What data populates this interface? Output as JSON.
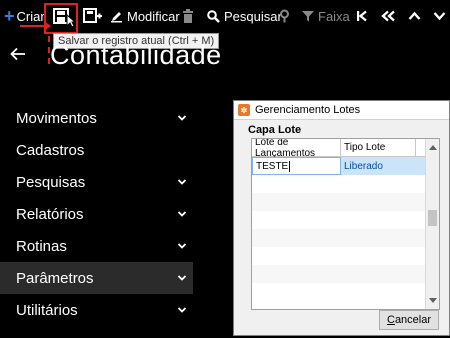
{
  "toolbar": {
    "criar": "Criar",
    "modificar": "Modificar",
    "pesquisar": "Pesquisar",
    "faixa": "Faixa",
    "tooltip": "Salvar o registro atual (Ctrl + M)"
  },
  "header": {
    "title": "Contabilidade"
  },
  "menu": {
    "items": [
      {
        "label": "Movimentos",
        "has_chevron": true
      },
      {
        "label": "Cadastros",
        "has_chevron": false
      },
      {
        "label": "Pesquisas",
        "has_chevron": true
      },
      {
        "label": "Relatórios",
        "has_chevron": true
      },
      {
        "label": "Rotinas",
        "has_chevron": true
      },
      {
        "label": "Parâmetros",
        "has_chevron": true,
        "active": true
      },
      {
        "label": "Utilitários",
        "has_chevron": true
      }
    ]
  },
  "dialog": {
    "title": "Gerenciamento Lotes",
    "section": "Capa Lote",
    "columns": [
      "Lote de Lançamentos",
      "Tipo Lote"
    ],
    "rows": [
      {
        "lote": "TESTE",
        "tipo": "Liberado"
      }
    ],
    "cancel_label": "Cancelar",
    "cancel_accesskey_underline": "C"
  },
  "colors": {
    "highlight_red": "#e02020",
    "selection": "#cce4f7",
    "accent_icon": "#3a7bd5"
  }
}
